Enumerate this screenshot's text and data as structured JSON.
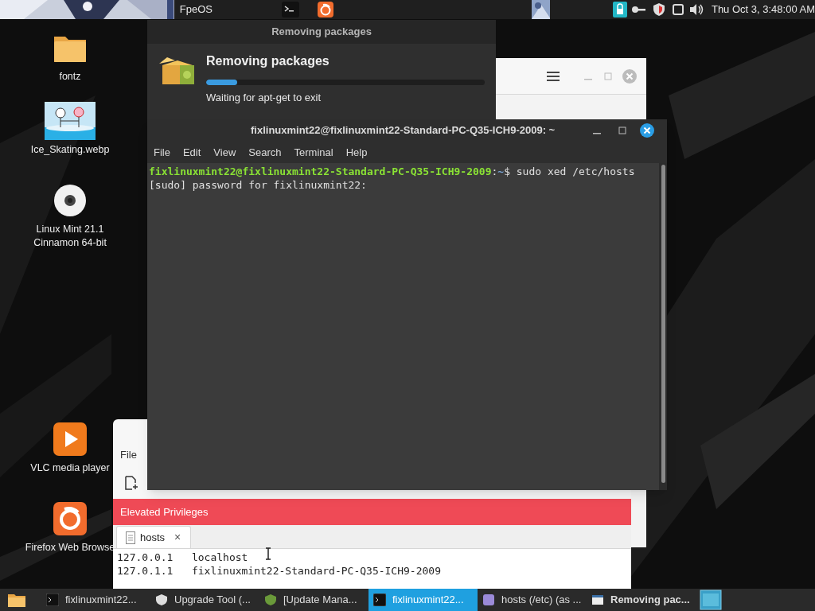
{
  "top_panel": {
    "launcher_label": "FpeOS",
    "clock": "Thu Oct 3, 3:48:00 AM"
  },
  "desktop_icons": [
    {
      "kind": "folder",
      "lines": [
        "fontz"
      ]
    },
    {
      "kind": "picture",
      "lines": [
        "Ice_Skating.webp"
      ]
    },
    {
      "kind": "disc",
      "lines": [
        "Linux Mint 21.1",
        "Cinnamon 64-bit"
      ]
    },
    {
      "kind": "vlc",
      "lines": [
        "VLC media player"
      ]
    },
    {
      "kind": "firefox",
      "lines": [
        "Firefox Web Browse"
      ]
    }
  ],
  "package_dialog": {
    "title": "Removing packages",
    "heading": "Removing packages",
    "level": 0.11,
    "status": "Waiting for apt-get to exit"
  },
  "terminal": {
    "title": "fixlinuxmint22@fixlinuxmint22-Standard-PC-Q35-ICH9-2009: ~",
    "menu": [
      "File",
      "Edit",
      "View",
      "Search",
      "Terminal",
      "Help"
    ],
    "lines": [
      [
        {
          "kind": "user",
          "text": "fixlinuxmint22@fixlinuxmint22-Standard-PC-Q35-ICH9-2009"
        },
        {
          "kind": "plain",
          "text": ":"
        },
        {
          "kind": "path",
          "text": "~"
        },
        {
          "kind": "plain",
          "text": "$ sudo xed /etc/hosts"
        }
      ],
      [
        {
          "kind": "plain",
          "text": "[sudo] password for fixlinuxmint22:"
        }
      ]
    ]
  },
  "editor": {
    "menu": [
      "File"
    ],
    "banner": "Elevated Privileges",
    "tabs": [
      {
        "label": "hosts",
        "close": "×",
        "selected": true
      }
    ],
    "lines": [
      "127.0.0.1   localhost",
      "127.0.1.1   fixlinuxmint22-Standard-PC-Q35-ICH9-2009"
    ]
  },
  "taskbar": {
    "items": [
      {
        "kind": "terminal",
        "label": "fixlinuxmint22...",
        "selected": false,
        "attention": false
      },
      {
        "kind": "shield",
        "label": "Upgrade Tool (...",
        "selected": false,
        "attention": false
      },
      {
        "kind": "update",
        "label": "[Update Mana...",
        "selected": false,
        "attention": false
      },
      {
        "kind": "terminal",
        "label": "fixlinuxmint22...",
        "selected": true,
        "attention": false
      },
      {
        "kind": "editor",
        "label": "hosts (/etc) (as ...",
        "selected": false,
        "attention": false
      },
      {
        "kind": "package",
        "label": "Removing pac...",
        "selected": false,
        "attention": true
      }
    ]
  }
}
